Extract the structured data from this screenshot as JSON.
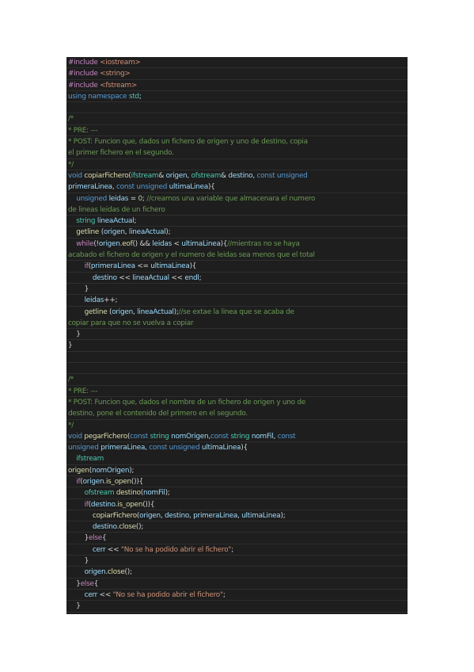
{
  "colors": {
    "page_background": "#ffffff",
    "editor_background": "#1e1e1e",
    "preprocessor": "#c586c0",
    "keyword": "#569cd6",
    "type": "#4ec9b0",
    "function": "#dcdcaa",
    "variable": "#9cdcfe",
    "comment": "#6a9955",
    "string": "#ce9178",
    "number": "#b5cea8",
    "plain": "#d4d4d4"
  },
  "code_lines": [
    [
      [
        "pp",
        "#include "
      ],
      [
        "str",
        "<iostream>"
      ]
    ],
    [
      [
        "pp",
        "#include "
      ],
      [
        "str",
        "<string>"
      ]
    ],
    [
      [
        "pp",
        "#include "
      ],
      [
        "str",
        "<fstream>"
      ]
    ],
    [
      [
        "kw",
        "using "
      ],
      [
        "kw",
        "namespace "
      ],
      [
        "ty",
        "std"
      ],
      [
        "pl",
        ";"
      ]
    ],
    [],
    [
      [
        "cm",
        "/*"
      ]
    ],
    [
      [
        "cm",
        "* PRE: ---"
      ]
    ],
    [
      [
        "cm",
        "* POST: Funcion que, dados un fichero de origen y uno de destino, copia"
      ]
    ],
    [
      [
        "cm",
        "el primer fichero en el segundo."
      ]
    ],
    [
      [
        "cm",
        "*/"
      ]
    ],
    [
      [
        "kw",
        "void "
      ],
      [
        "fn",
        "copiarFichero"
      ],
      [
        "pl",
        "("
      ],
      [
        "ty",
        "ifstream"
      ],
      [
        "pl",
        "& "
      ],
      [
        "var",
        "origen"
      ],
      [
        "pl",
        ", "
      ],
      [
        "ty",
        "ofstream"
      ],
      [
        "pl",
        "& "
      ],
      [
        "var",
        "destino"
      ],
      [
        "pl",
        ", "
      ],
      [
        "kw",
        "const "
      ],
      [
        "kw",
        "unsigned"
      ]
    ],
    [
      [
        "var",
        "primeraLinea"
      ],
      [
        "pl",
        ", "
      ],
      [
        "kw",
        "const "
      ],
      [
        "kw",
        "unsigned "
      ],
      [
        "var",
        "ultimaLinea"
      ],
      [
        "pl",
        "){"
      ]
    ],
    [
      [
        "pl",
        "    "
      ],
      [
        "kw",
        "unsigned "
      ],
      [
        "var",
        "leidas"
      ],
      [
        "pl",
        " = "
      ],
      [
        "num",
        "0"
      ],
      [
        "pl",
        "; "
      ],
      [
        "cm",
        "//creamos una variable que almacenara el numero"
      ]
    ],
    [
      [
        "cm",
        "de lineas leidas de un fichero"
      ]
    ],
    [
      [
        "pl",
        "    "
      ],
      [
        "ty",
        "string "
      ],
      [
        "var",
        "lineaActual"
      ],
      [
        "pl",
        ";"
      ]
    ],
    [
      [
        "pl",
        "    "
      ],
      [
        "fn",
        "getline "
      ],
      [
        "pl",
        "("
      ],
      [
        "var",
        "origen"
      ],
      [
        "pl",
        ", "
      ],
      [
        "var",
        "lineaActual"
      ],
      [
        "pl",
        ");"
      ]
    ],
    [
      [
        "pl",
        "    "
      ],
      [
        "ctl",
        "while"
      ],
      [
        "pl",
        "(!"
      ],
      [
        "var",
        "origen"
      ],
      [
        "pl",
        "."
      ],
      [
        "fn",
        "eof"
      ],
      [
        "pl",
        "() && "
      ],
      [
        "var",
        "leidas"
      ],
      [
        "pl",
        " < "
      ],
      [
        "var",
        "ultimaLinea"
      ],
      [
        "pl",
        "){"
      ],
      [
        "cm",
        "//mientras no se haya"
      ]
    ],
    [
      [
        "cm",
        "acabado el fichero de origen y el numero de leidas sea menos que el total"
      ]
    ],
    [
      [
        "pl",
        "        "
      ],
      [
        "ctl",
        "if"
      ],
      [
        "pl",
        "("
      ],
      [
        "var",
        "primeraLinea"
      ],
      [
        "pl",
        " <= "
      ],
      [
        "var",
        "ultimaLinea"
      ],
      [
        "pl",
        "){"
      ]
    ],
    [
      [
        "pl",
        "            "
      ],
      [
        "var",
        "destino"
      ],
      [
        "pl",
        " << "
      ],
      [
        "var",
        "lineaActual"
      ],
      [
        "pl",
        " << "
      ],
      [
        "var",
        "endl"
      ],
      [
        "pl",
        ";"
      ]
    ],
    [
      [
        "pl",
        "        }"
      ]
    ],
    [
      [
        "pl",
        "        "
      ],
      [
        "var",
        "leidas"
      ],
      [
        "pl",
        "++;"
      ]
    ],
    [
      [
        "pl",
        "        "
      ],
      [
        "fn",
        "getline "
      ],
      [
        "pl",
        "("
      ],
      [
        "var",
        "origen"
      ],
      [
        "pl",
        ", "
      ],
      [
        "var",
        "lineaActual"
      ],
      [
        "pl",
        ");"
      ],
      [
        "cm",
        "//se extae la linea que se acaba de"
      ]
    ],
    [
      [
        "cm",
        "copiar para que no se vuelva a copiar"
      ]
    ],
    [
      [
        "pl",
        "    }"
      ]
    ],
    [
      [
        "pl",
        "}"
      ]
    ],
    [],
    [],
    [
      [
        "cm",
        "/*"
      ]
    ],
    [
      [
        "cm",
        "* PRE: ---"
      ]
    ],
    [
      [
        "cm",
        "* POST: Funcion que, dados el nombre de un fichero de origen y uno de"
      ]
    ],
    [
      [
        "cm",
        "destino, pone el contenido del primero en el segundo."
      ]
    ],
    [
      [
        "cm",
        "*/"
      ]
    ],
    [
      [
        "kw",
        "void "
      ],
      [
        "fn",
        "pegarFichero"
      ],
      [
        "pl",
        "("
      ],
      [
        "kw",
        "const "
      ],
      [
        "ty",
        "string "
      ],
      [
        "var",
        "nomOrigen"
      ],
      [
        "pl",
        ","
      ],
      [
        "kw",
        "const "
      ],
      [
        "ty",
        "string "
      ],
      [
        "var",
        "nomFil"
      ],
      [
        "pl",
        ", "
      ],
      [
        "kw",
        "const"
      ]
    ],
    [
      [
        "kw",
        "unsigned "
      ],
      [
        "var",
        "primeraLinea"
      ],
      [
        "pl",
        ", "
      ],
      [
        "kw",
        "const "
      ],
      [
        "kw",
        "unsigned "
      ],
      [
        "var",
        "ultimaLinea"
      ],
      [
        "pl",
        "){"
      ]
    ],
    [
      [
        "pl",
        "    "
      ],
      [
        "ty",
        "ifstream"
      ]
    ],
    [
      [
        "fn",
        "origen"
      ],
      [
        "pl",
        "("
      ],
      [
        "var",
        "nomOrigen"
      ],
      [
        "pl",
        ");"
      ]
    ],
    [
      [
        "pl",
        "    "
      ],
      [
        "ctl",
        "if"
      ],
      [
        "pl",
        "("
      ],
      [
        "var",
        "origen"
      ],
      [
        "pl",
        "."
      ],
      [
        "fn",
        "is_open"
      ],
      [
        "pl",
        "()){"
      ]
    ],
    [
      [
        "pl",
        "        "
      ],
      [
        "ty",
        "ofstream "
      ],
      [
        "fn",
        "destino"
      ],
      [
        "pl",
        "("
      ],
      [
        "var",
        "nomFil"
      ],
      [
        "pl",
        ");"
      ]
    ],
    [
      [
        "pl",
        "        "
      ],
      [
        "ctl",
        "if"
      ],
      [
        "pl",
        "("
      ],
      [
        "var",
        "destino"
      ],
      [
        "pl",
        "."
      ],
      [
        "fn",
        "is_open"
      ],
      [
        "pl",
        "()){"
      ]
    ],
    [
      [
        "pl",
        "            "
      ],
      [
        "fn",
        "copiarFichero"
      ],
      [
        "pl",
        "("
      ],
      [
        "var",
        "origen"
      ],
      [
        "pl",
        ", "
      ],
      [
        "var",
        "destino"
      ],
      [
        "pl",
        ", "
      ],
      [
        "var",
        "primeraLinea"
      ],
      [
        "pl",
        ", "
      ],
      [
        "var",
        "ultimaLinea"
      ],
      [
        "pl",
        ");"
      ]
    ],
    [
      [
        "pl",
        "            "
      ],
      [
        "var",
        "destino"
      ],
      [
        "pl",
        "."
      ],
      [
        "fn",
        "close"
      ],
      [
        "pl",
        "();"
      ]
    ],
    [
      [
        "pl",
        "        }"
      ],
      [
        "ctl",
        "else"
      ],
      [
        "pl",
        "{"
      ]
    ],
    [
      [
        "pl",
        "            "
      ],
      [
        "var",
        "cerr"
      ],
      [
        "pl",
        " << "
      ],
      [
        "str",
        "\"No se ha podido abrir el fichero\""
      ],
      [
        "pl",
        ";"
      ]
    ],
    [
      [
        "pl",
        "        }"
      ]
    ],
    [
      [
        "pl",
        "        "
      ],
      [
        "var",
        "origen"
      ],
      [
        "pl",
        "."
      ],
      [
        "fn",
        "close"
      ],
      [
        "pl",
        "();"
      ]
    ],
    [
      [
        "pl",
        "    }"
      ],
      [
        "ctl",
        "else"
      ],
      [
        "pl",
        "{"
      ]
    ],
    [
      [
        "pl",
        "        "
      ],
      [
        "var",
        "cerr"
      ],
      [
        "pl",
        " << "
      ],
      [
        "str",
        "\"No se ha podido abrir el fichero\""
      ],
      [
        "pl",
        ";"
      ]
    ],
    [
      [
        "pl",
        "    }"
      ]
    ],
    [
      [
        "pl",
        "}"
      ]
    ]
  ],
  "continuation_lines": [
    8,
    11,
    13,
    17,
    23,
    31,
    33,
    35
  ]
}
